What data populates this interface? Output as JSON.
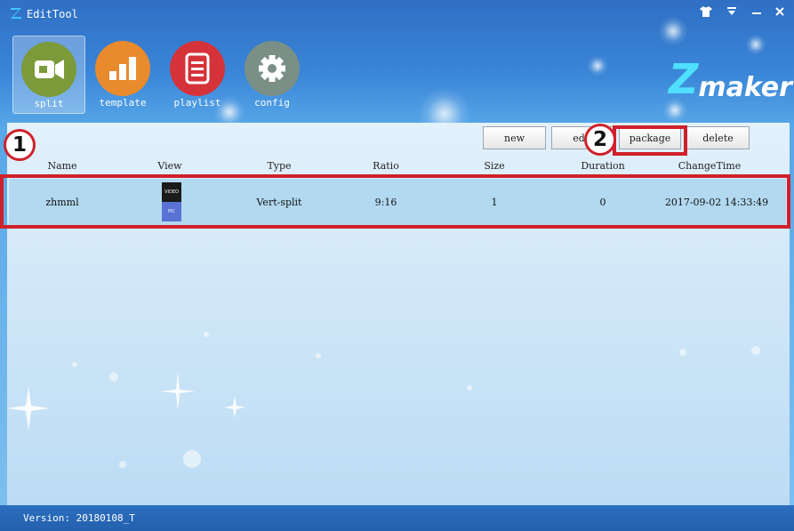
{
  "window": {
    "title": "EditTool",
    "controls": [
      "shirt-icon",
      "dropdown-icon",
      "minimize-icon",
      "close-icon"
    ]
  },
  "nav": {
    "items": [
      {
        "label": "split",
        "icon": "video-camera-icon",
        "color": "#7c9a3a",
        "active": true
      },
      {
        "label": "template",
        "icon": "bar-chart-icon",
        "color": "#e98a2c",
        "active": false
      },
      {
        "label": "playlist",
        "icon": "document-list-icon",
        "color": "#d6323a",
        "active": false
      },
      {
        "label": "config",
        "icon": "gear-icon",
        "color": "#7a8f86",
        "active": false
      }
    ]
  },
  "brand": {
    "text": "maker",
    "letter": "Z"
  },
  "toolbar": {
    "new_label": "new",
    "edit_label": "edit",
    "package_label": "package",
    "delete_label": "delete"
  },
  "table": {
    "columns": [
      "Name",
      "View",
      "Type",
      "Ratio",
      "Size",
      "Duration",
      "ChangeTime"
    ],
    "rows": [
      {
        "name": "zhmml",
        "view_top": "VIDEO",
        "view_bottom": "PIC",
        "type": "Vert-split",
        "ratio": "9:16",
        "size": "1",
        "duration": "0",
        "change_time": "2017-09-02 14:33:49"
      }
    ]
  },
  "callouts": [
    "1",
    "2"
  ],
  "status": {
    "version": "Version: 20180108_T"
  },
  "colors": {
    "highlight": "#d0212b",
    "row_selected": "#b2d9f0"
  }
}
